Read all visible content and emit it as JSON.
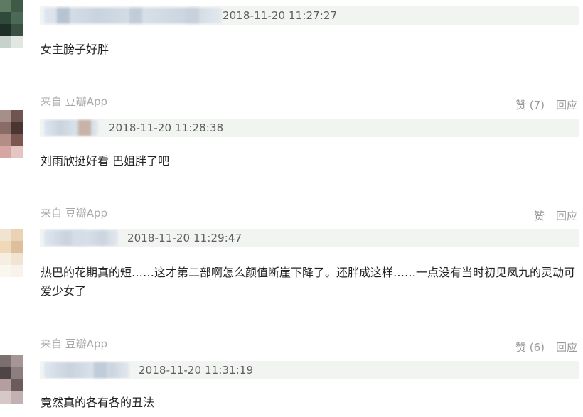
{
  "comments": [
    {
      "time": "2018-11-20 11:27:27",
      "text": "女主膀子好胖",
      "source": "来自 豆瓣App",
      "like_label": "赞 (7)",
      "reply_label": "回应"
    },
    {
      "time": "2018-11-20 11:28:38",
      "text": "刘雨欣挺好看 巴姐胖了吧",
      "source": "来自 豆瓣App",
      "like_label": "赞",
      "reply_label": "回应"
    },
    {
      "time": "2018-11-20 11:29:47",
      "text": "热巴的花期真的短……这才第二部啊怎么颜值断崖下降了。还胖成这样……一点没有当时初见凤九的灵动可爱少女了",
      "source": "来自 豆瓣App",
      "like_label": "赞 (6)",
      "reply_label": "回应"
    },
    {
      "time": "2018-11-20 11:31:19",
      "text": "竟然真的各有各的丑法"
    }
  ],
  "colors": {
    "meta_bar": "#f1f4f1",
    "text": "#222222",
    "muted": "#a8a8a8"
  }
}
